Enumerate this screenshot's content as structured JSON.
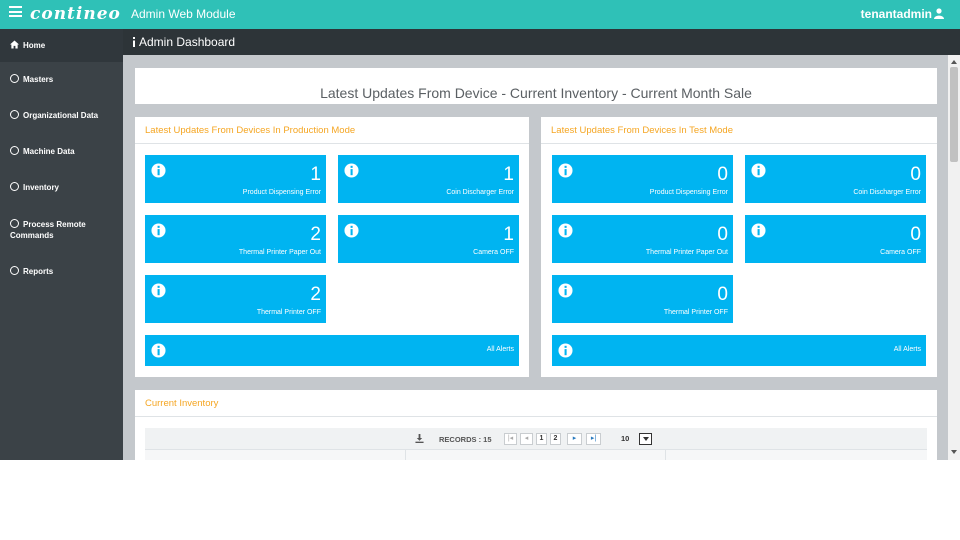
{
  "app": {
    "logo": "contineo",
    "module_title": "Admin Web Module",
    "user": "tenantadmin"
  },
  "sidebar": {
    "items": [
      {
        "label": "Home",
        "icon": "home-icon"
      },
      {
        "label": "Masters",
        "icon": "circle-icon"
      },
      {
        "label": "Organizational Data",
        "icon": "circle-icon"
      },
      {
        "label": "Machine Data",
        "icon": "circle-icon"
      },
      {
        "label": "Inventory",
        "icon": "circle-icon"
      },
      {
        "label": "Process Remote Commands",
        "icon": "circle-icon"
      },
      {
        "label": "Reports",
        "icon": "circle-icon"
      }
    ]
  },
  "header": {
    "title": "Admin Dashboard"
  },
  "main": {
    "title": "Latest Updates From Device - Current Inventory - Current Month Sale",
    "production": {
      "title": "Latest Updates From Devices In Production Mode",
      "cards": [
        {
          "value": "1",
          "label": "Product Dispensing Error"
        },
        {
          "value": "1",
          "label": "Coin Discharger Error"
        },
        {
          "value": "2",
          "label": "Thermal Printer Paper Out"
        },
        {
          "value": "1",
          "label": "Camera OFF"
        },
        {
          "value": "2",
          "label": "Thermal Printer OFF"
        }
      ],
      "all_alerts": "All Alerts"
    },
    "test": {
      "title": "Latest Updates From Devices In Test Mode",
      "cards": [
        {
          "value": "0",
          "label": "Product Dispensing Error"
        },
        {
          "value": "0",
          "label": "Coin Discharger Error"
        },
        {
          "value": "0",
          "label": "Thermal Printer Paper Out"
        },
        {
          "value": "0",
          "label": "Camera OFF"
        },
        {
          "value": "0",
          "label": "Thermal Printer OFF"
        }
      ],
      "all_alerts": "All Alerts"
    },
    "inventory": {
      "title": "Current Inventory",
      "records": "RECORDS : 15",
      "pages": [
        "1",
        "2"
      ],
      "first": "|◂",
      "prev": "◂",
      "next": "▸",
      "last": "▸|",
      "page_size": "10"
    }
  },
  "colors": {
    "topbar": "#2fc1b7",
    "sidebar": "#3b4247",
    "card": "#00b4f1",
    "panel_title": "#f5a623"
  }
}
